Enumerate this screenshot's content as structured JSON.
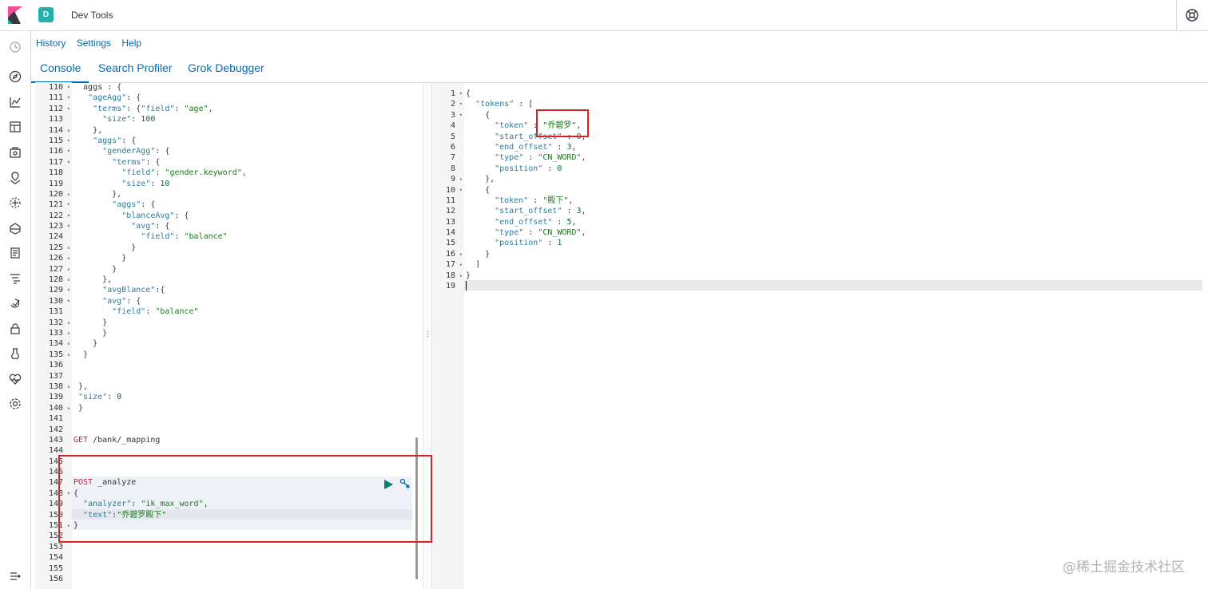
{
  "header": {
    "space_initial": "D",
    "title": "Dev Tools"
  },
  "menu": [
    "History",
    "Settings",
    "Help"
  ],
  "tabs": [
    "Console",
    "Search Profiler",
    "Grok Debugger"
  ],
  "left_editor": {
    "lines": [
      {
        "n": "110",
        "f": "fold",
        "t": "  aggs : {"
      },
      {
        "n": "111",
        "f": "fold",
        "t": "   \"ageAgg\": {"
      },
      {
        "n": "112",
        "f": "fold",
        "t": "    \"terms\": {\"field\": \"age\","
      },
      {
        "n": "113",
        "f": "",
        "t": "      \"size\": 100"
      },
      {
        "n": "114",
        "f": "foldup",
        "t": "    },"
      },
      {
        "n": "115",
        "f": "fold",
        "t": "    \"aggs\": {"
      },
      {
        "n": "116",
        "f": "fold",
        "t": "      \"genderAgg\": {"
      },
      {
        "n": "117",
        "f": "fold",
        "t": "        \"terms\": {"
      },
      {
        "n": "118",
        "f": "",
        "t": "          \"field\": \"gender.keyword\","
      },
      {
        "n": "119",
        "f": "",
        "t": "          \"size\": 10"
      },
      {
        "n": "120",
        "f": "foldup",
        "t": "        },"
      },
      {
        "n": "121",
        "f": "fold",
        "t": "        \"aggs\": {"
      },
      {
        "n": "122",
        "f": "fold",
        "t": "          \"blanceAvg\": {"
      },
      {
        "n": "123",
        "f": "fold",
        "t": "            \"avg\": {"
      },
      {
        "n": "124",
        "f": "",
        "t": "              \"field\": \"balance\""
      },
      {
        "n": "125",
        "f": "foldup",
        "t": "            }"
      },
      {
        "n": "126",
        "f": "foldup",
        "t": "          }"
      },
      {
        "n": "127",
        "f": "foldup",
        "t": "        }"
      },
      {
        "n": "128",
        "f": "foldup",
        "t": "      },"
      },
      {
        "n": "129",
        "f": "fold",
        "t": "      \"avgBlance\":{"
      },
      {
        "n": "130",
        "f": "fold",
        "t": "      \"avg\": {"
      },
      {
        "n": "131",
        "f": "",
        "t": "        \"field\": \"balance\""
      },
      {
        "n": "132",
        "f": "foldup",
        "t": "      }"
      },
      {
        "n": "133",
        "f": "foldup",
        "t": "      }"
      },
      {
        "n": "134",
        "f": "foldup",
        "t": "    }"
      },
      {
        "n": "135",
        "f": "foldup",
        "t": "  }"
      },
      {
        "n": "136",
        "f": "",
        "t": ""
      },
      {
        "n": "137",
        "f": "",
        "t": ""
      },
      {
        "n": "138",
        "f": "foldup",
        "t": " },"
      },
      {
        "n": "139",
        "f": "",
        "t": " \"size\": 0"
      },
      {
        "n": "140",
        "f": "foldup",
        "t": " }"
      },
      {
        "n": "141",
        "f": "",
        "t": ""
      },
      {
        "n": "142",
        "f": "",
        "t": ""
      },
      {
        "n": "143",
        "f": "",
        "t": "GET /bank/_mapping"
      },
      {
        "n": "144",
        "f": "",
        "t": ""
      },
      {
        "n": "145",
        "f": "",
        "t": ""
      },
      {
        "n": "146",
        "f": "",
        "t": ""
      },
      {
        "n": "147",
        "f": "",
        "t": "POST _analyze"
      },
      {
        "n": "148",
        "f": "fold",
        "t": "{"
      },
      {
        "n": "149",
        "f": "",
        "t": "  \"analyzer\": \"ik_max_word\","
      },
      {
        "n": "150",
        "f": "",
        "t": "  \"text\":\"乔碧罗殿下\""
      },
      {
        "n": "151",
        "f": "foldup",
        "t": "}"
      },
      {
        "n": "152",
        "f": "",
        "t": ""
      },
      {
        "n": "153",
        "f": "",
        "t": ""
      },
      {
        "n": "154",
        "f": "",
        "t": ""
      },
      {
        "n": "155",
        "f": "",
        "t": ""
      },
      {
        "n": "156",
        "f": "",
        "t": ""
      }
    ]
  },
  "right_editor": {
    "lines": [
      {
        "n": "1",
        "f": "fold",
        "t": "{"
      },
      {
        "n": "2",
        "f": "fold",
        "t": "  \"tokens\" : ["
      },
      {
        "n": "3",
        "f": "fold",
        "t": "    {"
      },
      {
        "n": "4",
        "f": "",
        "t": "      \"token\" : \"乔碧罗\","
      },
      {
        "n": "5",
        "f": "",
        "t": "      \"start_offset\" : 0,"
      },
      {
        "n": "6",
        "f": "",
        "t": "      \"end_offset\" : 3,"
      },
      {
        "n": "7",
        "f": "",
        "t": "      \"type\" : \"CN_WORD\","
      },
      {
        "n": "8",
        "f": "",
        "t": "      \"position\" : 0"
      },
      {
        "n": "9",
        "f": "foldup",
        "t": "    },"
      },
      {
        "n": "10",
        "f": "fold",
        "t": "    {"
      },
      {
        "n": "11",
        "f": "",
        "t": "      \"token\" : \"殿下\","
      },
      {
        "n": "12",
        "f": "",
        "t": "      \"start_offset\" : 3,"
      },
      {
        "n": "13",
        "f": "",
        "t": "      \"end_offset\" : 5,"
      },
      {
        "n": "14",
        "f": "",
        "t": "      \"type\" : \"CN_WORD\","
      },
      {
        "n": "15",
        "f": "",
        "t": "      \"position\" : 1"
      },
      {
        "n": "16",
        "f": "foldup",
        "t": "    }"
      },
      {
        "n": "17",
        "f": "foldup",
        "t": "  ]"
      },
      {
        "n": "18",
        "f": "foldup",
        "t": "}"
      },
      {
        "n": "19",
        "f": "",
        "t": ""
      }
    ]
  },
  "watermark": "@稀土掘金技术社区",
  "colors": {
    "accent": "#006bb4",
    "badge": "#20b2aa",
    "highlight_box": "#e02020"
  },
  "icons": {
    "nav": [
      "clock-icon",
      "compass-icon",
      "visualize-icon",
      "dashboard-icon",
      "canvas-icon",
      "maps-icon",
      "ml-icon",
      "infrastructure-icon",
      "logs-icon",
      "apm-icon",
      "uptime-icon",
      "siem-icon",
      "devtools-icon",
      "monitoring-icon",
      "management-icon",
      "collapse-icon"
    ]
  }
}
